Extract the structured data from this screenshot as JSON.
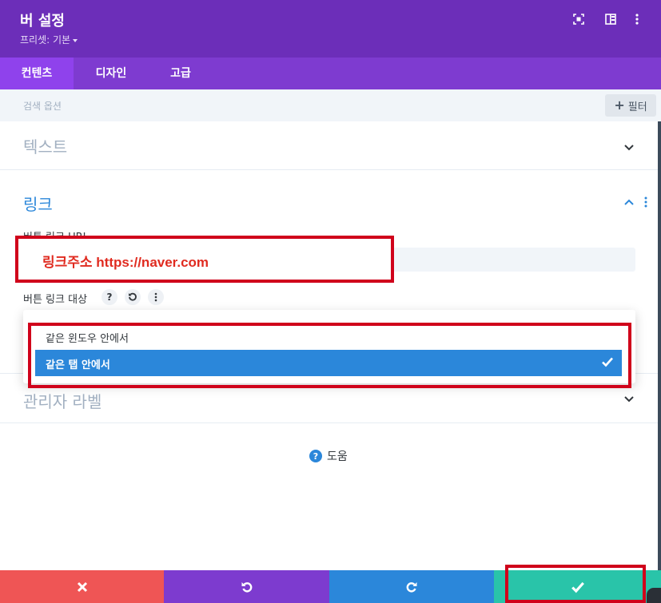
{
  "header": {
    "title": "버 설정",
    "preset": "프리셋: 기본",
    "icons": [
      "expand-icon",
      "sidebar-layout-icon",
      "more-vertical-icon"
    ]
  },
  "tabs": [
    {
      "label": "컨텐츠",
      "active": true
    },
    {
      "label": "디자인",
      "active": false
    },
    {
      "label": "고급",
      "active": false
    }
  ],
  "search": {
    "label": "검색 옵션",
    "filter_label": "필터"
  },
  "sections": {
    "text": {
      "title": "텍스트",
      "expanded": false
    },
    "link": {
      "title": "링크",
      "expanded": true
    },
    "admin": {
      "title": "관리자 라벨",
      "expanded": false
    }
  },
  "link_fields": {
    "url_label": "버튼 링크 URL",
    "url_value": "링크주소 https://naver.com",
    "target_label": "버튼 링크 대상",
    "target_options": [
      {
        "label": "같은 윈도우 안에서",
        "selected": false
      },
      {
        "label": "같은 탭 안에서",
        "selected": true
      }
    ]
  },
  "help": {
    "label": "도움"
  },
  "footer": {
    "buttons": [
      {
        "name": "cancel",
        "color": "#ef5555"
      },
      {
        "name": "undo",
        "color": "#7d3bcf"
      },
      {
        "name": "redo",
        "color": "#2b87da"
      },
      {
        "name": "save",
        "color": "#29c4a9"
      }
    ]
  },
  "colors": {
    "header": "#6c2eb9",
    "tabs": "#7e3bd0",
    "active_tab": "#8f42ec",
    "accent_blue": "#2b87da",
    "highlight_red": "#d0021b"
  }
}
